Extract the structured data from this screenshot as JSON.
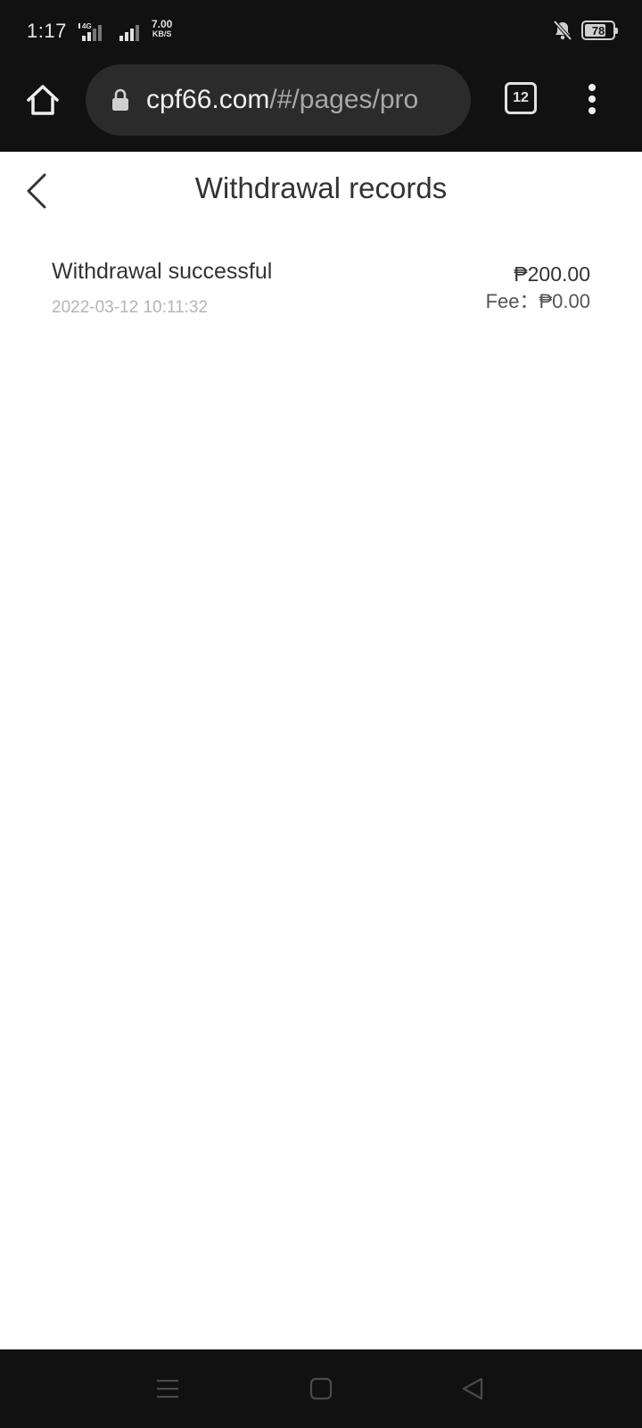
{
  "status_bar": {
    "time": "1:17",
    "network_type": "4G",
    "speed_value": "7.00",
    "speed_unit": "KB/S",
    "battery": "78",
    "battery_fraction": 0.78,
    "icons": [
      "signal-icon",
      "signal-icon",
      "bell-muted-icon",
      "battery-icon"
    ]
  },
  "browser": {
    "url_host": "cpf66.com",
    "url_path": "/#/pages/pro",
    "tab_count": "12",
    "icons": [
      "home-icon",
      "lock-icon",
      "tabs-icon",
      "more-vert-icon"
    ]
  },
  "page": {
    "title": "Withdrawal records",
    "back_icon": "chevron-left-icon"
  },
  "records": [
    {
      "status": "Withdrawal successful",
      "time": "2022-03-12 10:11:32",
      "amount": "₱200.00",
      "fee": "Fee：₱0.00"
    }
  ],
  "nav_bar": {
    "icons": [
      "menu-icon",
      "home-square-icon",
      "back-triangle-icon"
    ]
  },
  "colors": {
    "chrome_bg": "#111111",
    "url_pill_bg": "#2b2b2b",
    "text_primary": "#333333",
    "text_secondary": "#b5b5b5"
  }
}
